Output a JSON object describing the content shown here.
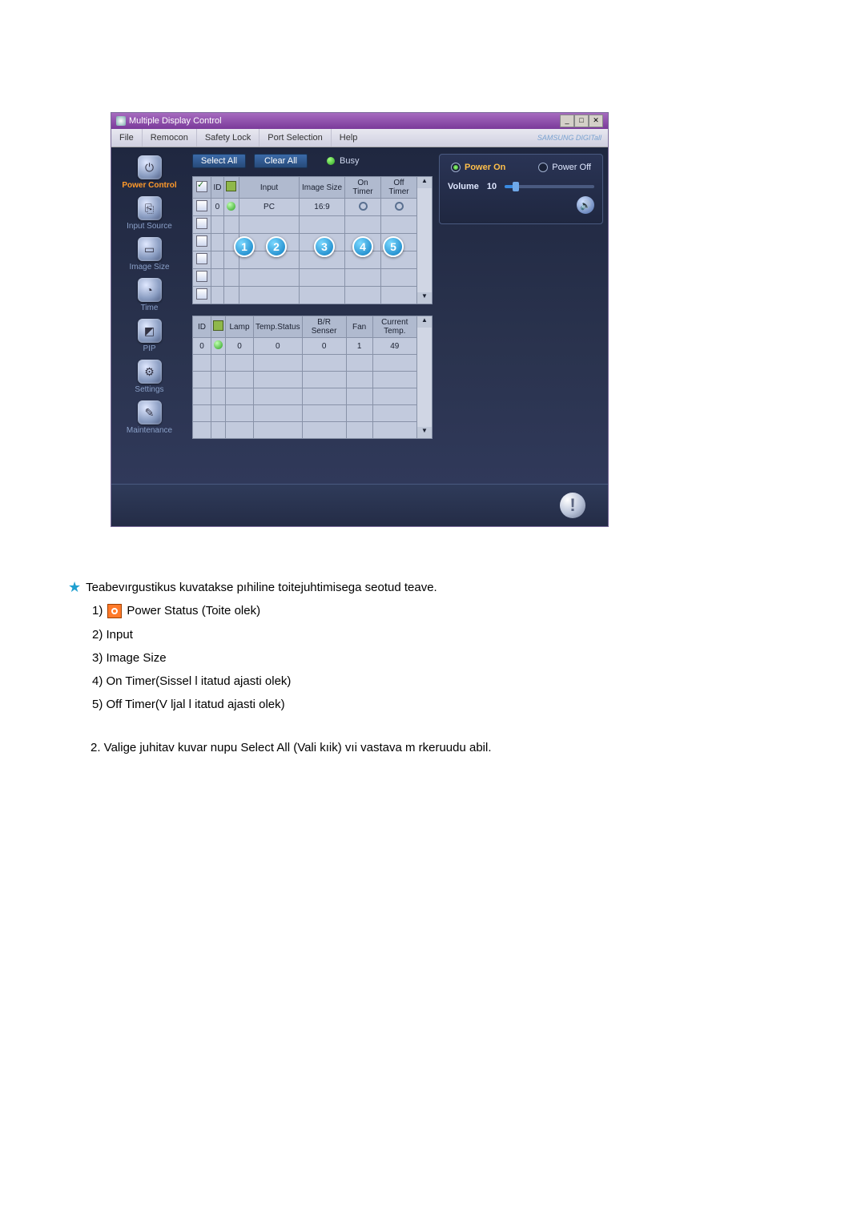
{
  "window": {
    "title": "Multiple Display Control"
  },
  "menu": {
    "file": "File",
    "remocon": "Remocon",
    "safety": "Safety Lock",
    "port": "Port Selection",
    "help": "Help",
    "brand": "SAMSUNG DIGITall"
  },
  "sidebar": {
    "power": "Power Control",
    "input": "Input Source",
    "image": "Image Size",
    "time": "Time",
    "pip": "PIP",
    "settings": "Settings",
    "maint": "Maintenance"
  },
  "toolbar": {
    "select_all": "Select All",
    "clear_all": "Clear All",
    "busy": "Busy"
  },
  "table1": {
    "h_id": "ID",
    "h_input": "Input",
    "h_imgsize": "Image Size",
    "h_ontimer": "On Timer",
    "h_offtimer": "Off Timer",
    "row0": {
      "id": "0",
      "input": "PC",
      "imgsize": "16:9"
    }
  },
  "table2": {
    "h_id": "ID",
    "h_lamp": "Lamp",
    "h_temp": "Temp.Status",
    "h_br": "B/R Senser",
    "h_fan": "Fan",
    "h_curtemp": "Current Temp.",
    "row0": {
      "id": "0",
      "lamp": "0",
      "temp": "0",
      "br": "0",
      "fan": "1",
      "cur": "49"
    }
  },
  "callouts": {
    "c1": "1",
    "c2": "2",
    "c3": "3",
    "c4": "4",
    "c5": "5"
  },
  "control": {
    "power_on": "Power On",
    "power_off": "Power Off",
    "volume_label": "Volume",
    "volume_value": "10"
  },
  "doc": {
    "intro": "Teabevırgustikus kuvatakse pıhiline toitejuhtimisega seotud teave.",
    "i1_pre": "1)",
    "i1_post": "Power Status (Toite olek)",
    "i2": "2) Input",
    "i3": "3) Image Size",
    "i4": "4) On Timer(Sissel l itatud ajasti olek)",
    "i5": "5) Off Timer(V ljal l   itatud ajasti olek)",
    "p2": "2.  Valige juhitav kuvar nupu Select All (Vali kıik) vıi vastava m rkeruudu abil."
  }
}
